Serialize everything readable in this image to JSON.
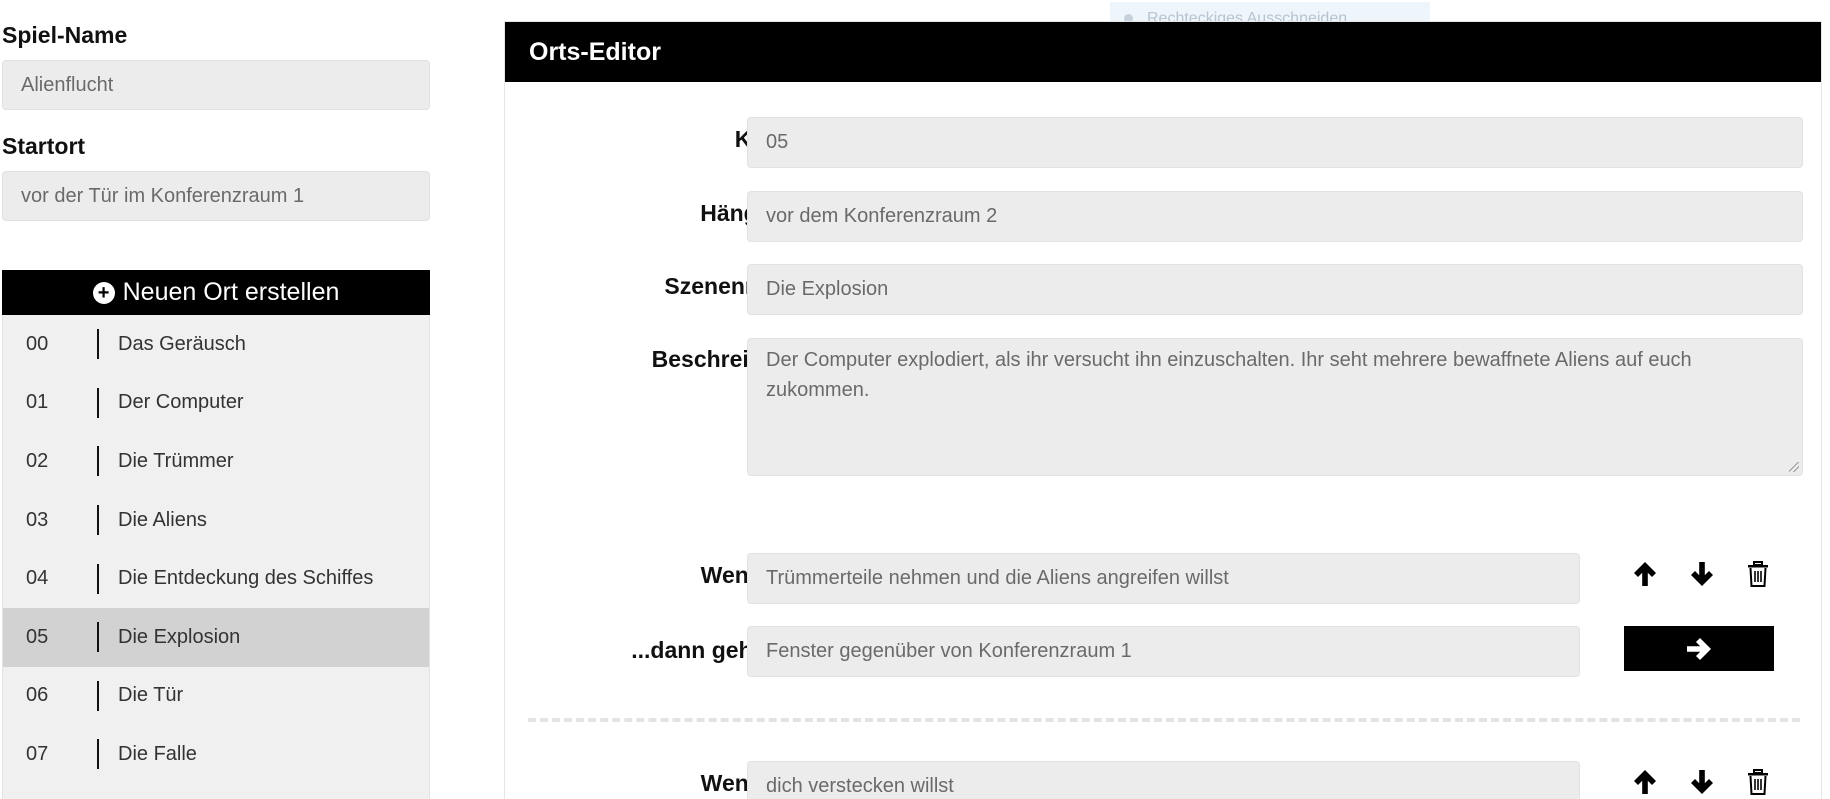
{
  "ghost_tooltip": {
    "text": "Rechteckiges Ausschneiden"
  },
  "game": {
    "name_label": "Spiel-Name",
    "name_value": "Alienflucht",
    "start_label": "Startort",
    "start_value": "vor der Tür im Konferenzraum 1"
  },
  "new_location": {
    "label": "Neuen Ort erstellen",
    "icon": "plus-circle-icon"
  },
  "locations": [
    {
      "code": "00",
      "name": "Das Geräusch"
    },
    {
      "code": "01",
      "name": "Der Computer"
    },
    {
      "code": "02",
      "name": "Die Trümmer"
    },
    {
      "code": "03",
      "name": "Die Aliens"
    },
    {
      "code": "04",
      "name": "Die Entdeckung des Schiffes"
    },
    {
      "code": "05",
      "name": "Die Explosion",
      "selected": true
    },
    {
      "code": "06",
      "name": "Die Tür"
    },
    {
      "code": "07",
      "name": "Die Falle"
    }
  ],
  "editor": {
    "title": "Orts-Editor",
    "kuerzel_label": "Kürzel",
    "kuerzel_value": "05",
    "parent_label": "Hängt bei",
    "parent_value": "vor dem Konferenzraum 2",
    "scene_label": "Szenenname",
    "scene_value": "Die Explosion",
    "desc_label": "Beschreibung",
    "desc_value": "Der Computer explodiert, als ihr versucht ihn einzuschalten. Ihr seht mehrere bewaffnete Aliens auf euch zukommen.",
    "choices": [
      {
        "if_label": "Wenn du:",
        "if_value": "Trümmerteile nehmen und die Aliens angreifen willst",
        "then_label": "...dann gehe zu:",
        "then_value": "Fenster gegenüber von Konferenzraum 1"
      },
      {
        "if_label": "Wenn du:",
        "if_value": "dich verstecken willst"
      }
    ]
  },
  "icons": {
    "up": "arrow-up-icon",
    "down": "arrow-down-icon",
    "delete": "trash-icon",
    "go": "arrow-right-icon"
  },
  "colors": {
    "header_bg": "#000000",
    "input_bg": "#ececec",
    "list_bg": "#f0f0f0",
    "selected_bg": "#d2d2d2"
  }
}
